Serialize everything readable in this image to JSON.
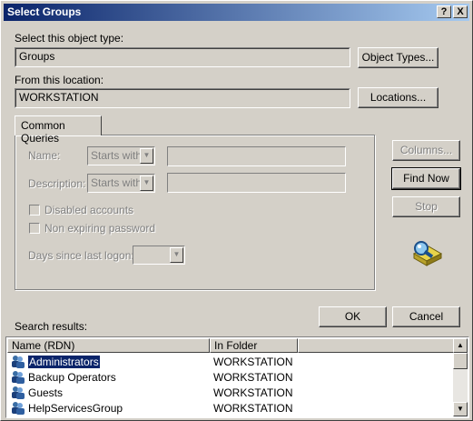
{
  "window": {
    "title": "Select Groups",
    "help_label": "?",
    "close_label": "X"
  },
  "object_type": {
    "label": "Select this object type:",
    "value": "Groups",
    "button": "Object Types..."
  },
  "location": {
    "label": "From this location:",
    "value": "WORKSTATION",
    "button": "Locations..."
  },
  "queries": {
    "tab": "Common Queries",
    "name_label": "Name:",
    "name_mode": "Starts with",
    "description_label": "Description:",
    "description_mode": "Starts with",
    "disabled_accounts": "Disabled accounts",
    "non_expiring_password": "Non expiring password",
    "days_since_logon": "Days since last logon:",
    "days_value": ""
  },
  "side_buttons": {
    "columns": "Columns...",
    "find_now": "Find Now",
    "stop": "Stop"
  },
  "footer": {
    "search_results": "Search results:",
    "ok": "OK",
    "cancel": "Cancel"
  },
  "results": {
    "columns": [
      "Name (RDN)",
      "In Folder"
    ],
    "rows": [
      {
        "name": "Administrators",
        "folder": "WORKSTATION",
        "selected": true
      },
      {
        "name": "Backup Operators",
        "folder": "WORKSTATION",
        "selected": false
      },
      {
        "name": "Guests",
        "folder": "WORKSTATION",
        "selected": false
      },
      {
        "name": "HelpServicesGroup",
        "folder": "WORKSTATION",
        "selected": false
      }
    ]
  },
  "colors": {
    "title_start": "#0a246a",
    "title_end": "#a6caf0",
    "selection": "#0a246a",
    "face": "#d4d0c8"
  }
}
